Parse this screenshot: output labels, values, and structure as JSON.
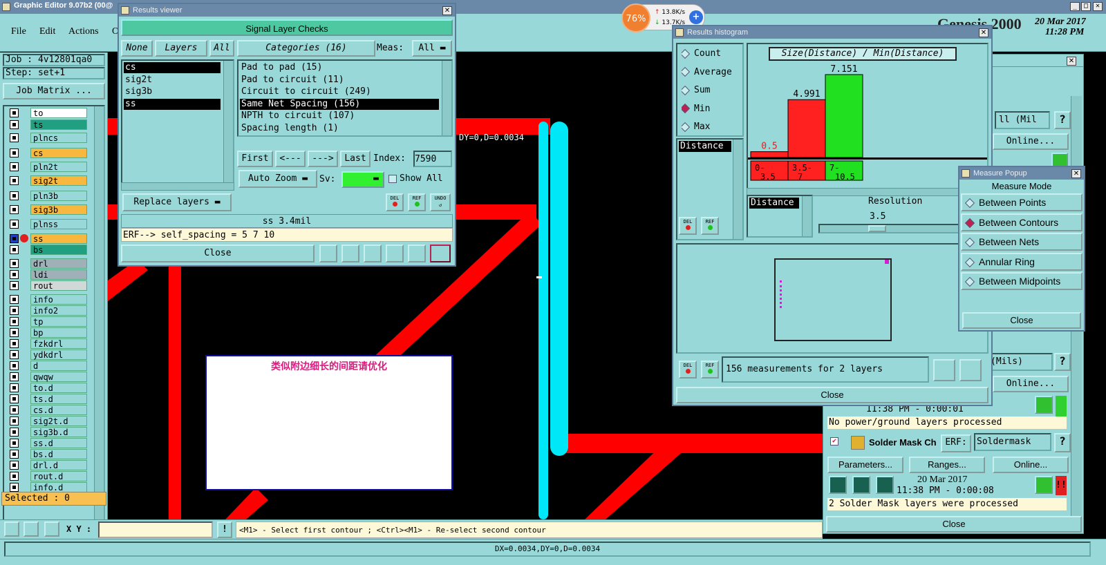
{
  "main_window": {
    "title": "Graphic Editor 9.07b2 (00@",
    "menu": [
      "File",
      "Edit",
      "Actions",
      "O"
    ],
    "job": "Job : 4v12801qa0",
    "step": "Step: set+1",
    "job_matrix": "Job Matrix ...",
    "selected": "Selected : 0",
    "xy_label": "X Y :",
    "status_hint": "<M1> - Select first contour ; <Ctrl><M1> - Re-select second contour",
    "bottom_readout": "DX=0.0034,DY=0,D=0.0034",
    "canvas_readout": "DY=0,D=0.0034",
    "annotation": "类似附边细长的间距请优化",
    "brand": "Genesis 2000",
    "date": "20 Mar 2017",
    "time": "11:28 PM"
  },
  "layers": [
    {
      "name": "to",
      "color": "#ffffff"
    },
    {
      "name": "ts",
      "color": "#20a080"
    },
    {
      "name": "plncs",
      "color": "#98d8d8"
    },
    {
      "name": "cs",
      "color": "#f8b840"
    },
    {
      "name": "pln2t",
      "color": "#98d8d8"
    },
    {
      "name": "sig2t",
      "color": "#f8b840"
    },
    {
      "name": "pln3b",
      "color": "#98d8d8"
    },
    {
      "name": "sig3b",
      "color": "#f8b840"
    },
    {
      "name": "plnss",
      "color": "#98d8d8"
    },
    {
      "name": "ss",
      "color": "#f8b840"
    },
    {
      "name": "bs",
      "color": "#20a080"
    },
    {
      "name": "drl",
      "color": "#a0b0b8"
    },
    {
      "name": "ldi",
      "color": "#a0b0b8"
    },
    {
      "name": "rout",
      "color": "#d0d8d8"
    },
    {
      "name": "info",
      "color": "#98d8d8"
    },
    {
      "name": "info2",
      "color": "#98d8d8"
    },
    {
      "name": "tp",
      "color": "#98d8d8"
    },
    {
      "name": "bp",
      "color": "#98d8d8"
    },
    {
      "name": "fzkdrl",
      "color": "#98d8d8"
    },
    {
      "name": "ydkdrl",
      "color": "#98d8d8"
    },
    {
      "name": "d",
      "color": "#98d8d8"
    },
    {
      "name": "qwqw",
      "color": "#98d8d8"
    },
    {
      "name": "to.d",
      "color": "#98d8d8"
    },
    {
      "name": "ts.d",
      "color": "#98d8d8"
    },
    {
      "name": "cs.d",
      "color": "#98d8d8"
    },
    {
      "name": "sig2t.d",
      "color": "#98d8d8"
    },
    {
      "name": "sig3b.d",
      "color": "#98d8d8"
    },
    {
      "name": "ss.d",
      "color": "#98d8d8"
    },
    {
      "name": "bs.d",
      "color": "#98d8d8"
    },
    {
      "name": "drl.d",
      "color": "#98d8d8"
    },
    {
      "name": "rout.d",
      "color": "#98d8d8"
    },
    {
      "name": "info.d",
      "color": "#98d8d8"
    }
  ],
  "results_viewer": {
    "title": "Results viewer",
    "header": "Signal Layer Checks",
    "none_btn": "None",
    "layers_btn": "Layers",
    "all_btn": "All",
    "categories_btn": "Categories (16)",
    "meas_label": "Meas:",
    "meas_value": "All",
    "layer_list": [
      "cs",
      "sig2t",
      "sig3b",
      "ss"
    ],
    "category_list": [
      "Pad to pad (15)",
      "Pad to circuit (11)",
      "Circuit to circuit (249)",
      "Same Net Spacing (156)",
      "NPTH to circuit (107)",
      "Spacing length (1)"
    ],
    "first": "First",
    "prev": "<---",
    "next": "--->",
    "last": "Last",
    "index_label": "Index:",
    "index_value": "7590",
    "auto_zoom": "Auto Zoom",
    "sv_label": "Sv:",
    "show_all": "Show All",
    "replace_layers": "Replace layers",
    "del": "DEL",
    "ref": "REF",
    "undo": "UNDO",
    "info": "ss 3.4mil",
    "erf": "ERF--> self_spacing = 5 7 10",
    "close": "Close"
  },
  "histogram": {
    "title": "Results histogram",
    "chart_title": "Size(Distance) / Min(Distance)",
    "modes": [
      "Count",
      "Average",
      "Sum",
      "Min",
      "Max"
    ],
    "selected_mode": "Min",
    "field": "Distance",
    "field2": "Distance",
    "resolution_label": "Resolution",
    "resolution_value": "3.5",
    "measurements": "156 measurements for 2 layers",
    "close": "Close",
    "del": "DEL",
    "ref": "REF"
  },
  "chart_data": {
    "type": "bar",
    "title": "Size(Distance) / Min(Distance)",
    "categories": [
      "0-3.5",
      "3.5-7",
      "7-10.5"
    ],
    "values": [
      0.5,
      4.991,
      7.151
    ],
    "value_labels": [
      "0.5",
      "4.991",
      "7.151"
    ],
    "colors": [
      "#ff2020",
      "#ff2020",
      "#20e020"
    ]
  },
  "measure_popup": {
    "title": "Measure Popup",
    "header": "Measure Mode",
    "modes": [
      "Between Points",
      "Between Contours",
      "Between Nets",
      "Annular Ring",
      "Between Midpoints"
    ],
    "selected": "Between Contours",
    "close": "Close"
  },
  "analysis_panel": {
    "mil_label1": "ll (Mil",
    "online": "Online...",
    "mils_label": "(Mils)",
    "online2": "Online...",
    "time1": "11:38 PM - 0:00:01",
    "msg1": "No power/ground layers processed",
    "solder_label": "Solder Mask Ch",
    "erf_label": "ERF:",
    "erf_value": "Soldermask",
    "parameters": "Parameters...",
    "ranges": "Ranges...",
    "online3": "Online...",
    "date2": "20 Mar 2017",
    "time2": "11:38 PM - 0:00:08",
    "msg2": "2 Solder Mask layers were processed",
    "close": "Close",
    "question": "?",
    "warn": "!!"
  },
  "net_widget": {
    "percent": "76%",
    "up": "13.8K/s",
    "down": "13.7K/s",
    "plus": "+"
  }
}
